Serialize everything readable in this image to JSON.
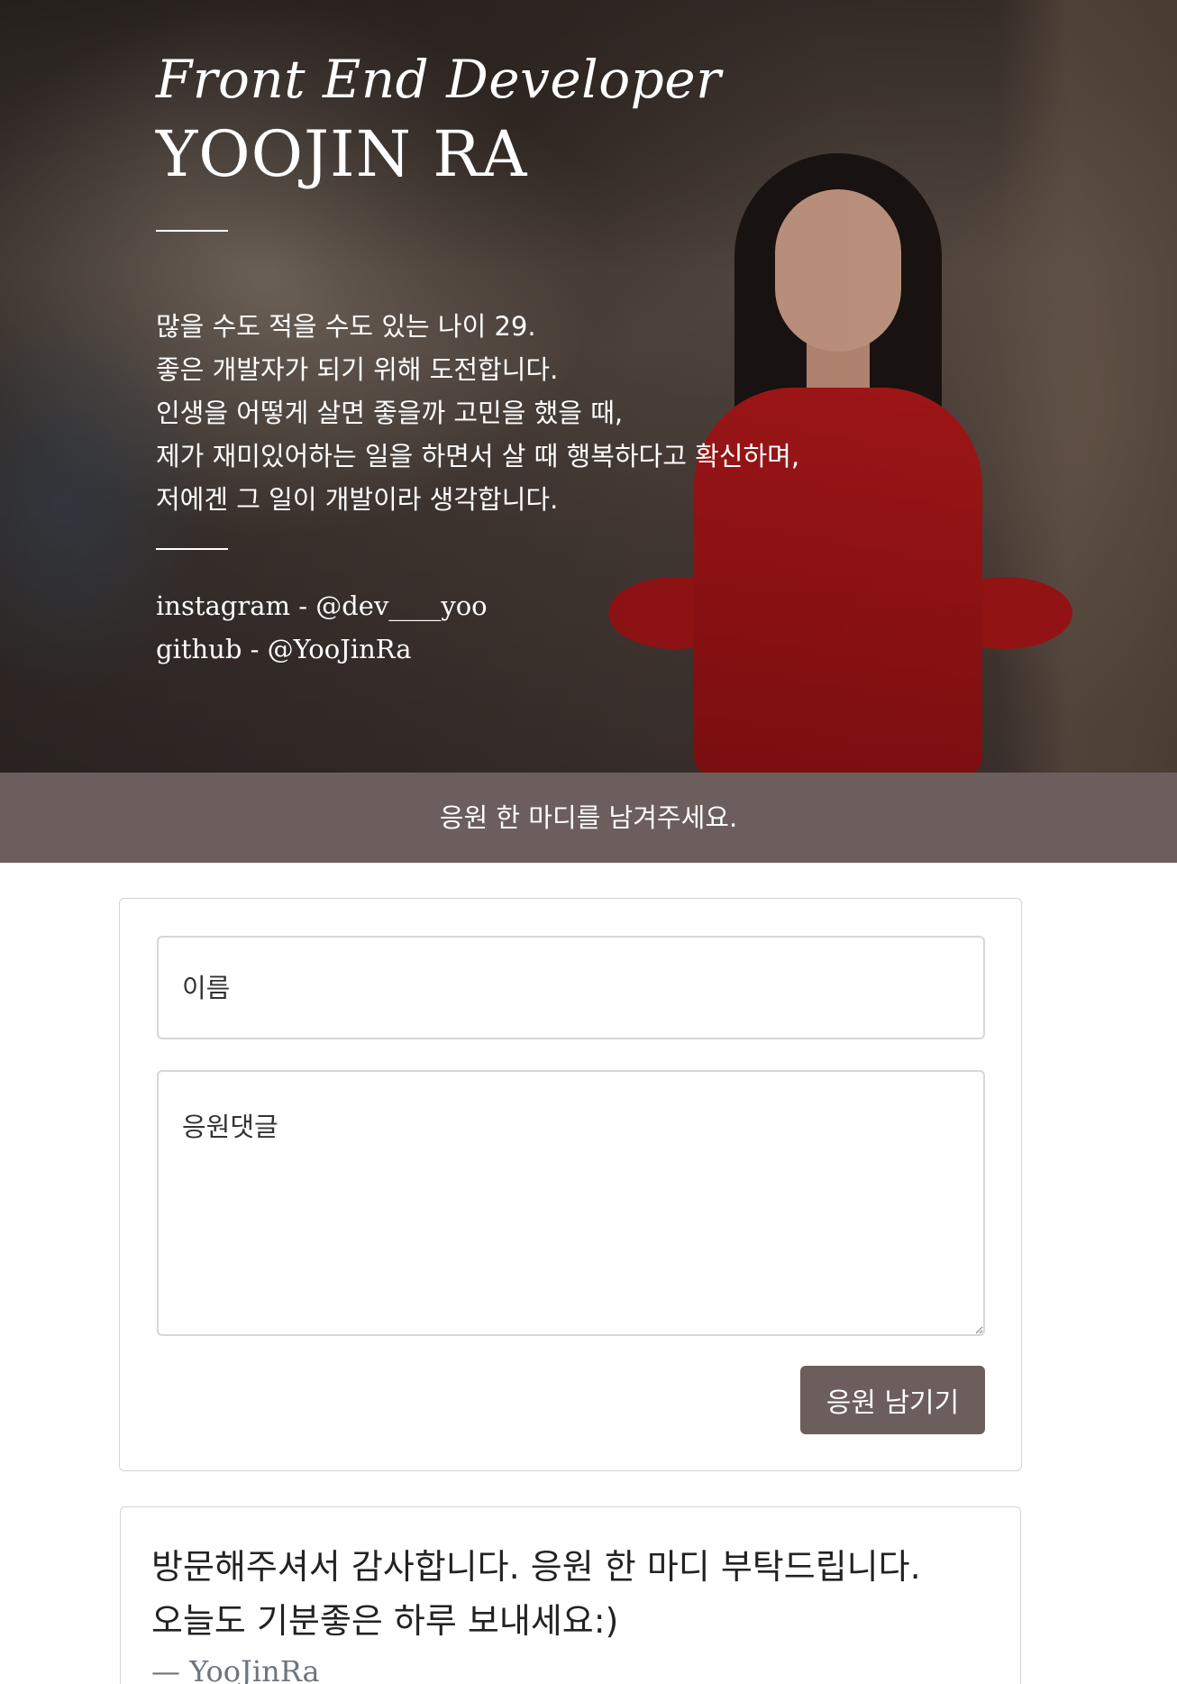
{
  "hero": {
    "role": "Front End Developer",
    "name": "YOOJIN RA",
    "intro_lines": [
      "많을 수도 적을 수도 있는 나이 29.",
      "좋은 개발자가 되기 위해 도전합니다.",
      "인생을 어떻게 살면 좋을까 고민을 했을 때,",
      "제가 재미있어하는 일을 하면서 살 때 행복하다고 확신하며,",
      "저에겐 그 일이 개발이라 생각합니다."
    ],
    "instagram": "instagram - @dev____yoo",
    "github": "github - @YooJinRa"
  },
  "banner": {
    "text": "응원 한 마디를 남겨주세요."
  },
  "form": {
    "name_placeholder": "이름",
    "comment_placeholder": "응원댓글",
    "submit_label": "응원 남기기"
  },
  "quote": {
    "line1": "방문해주셔서 감사합니다. 응원 한 마디 부탁드립니다.",
    "line2": "오늘도 기분좋은 하루 보내세요:)",
    "author": "— YooJinRa"
  },
  "colors": {
    "banner_bg": "#6b5e5d",
    "button_bg": "#6b5e5d",
    "dress": "#b3181a"
  }
}
